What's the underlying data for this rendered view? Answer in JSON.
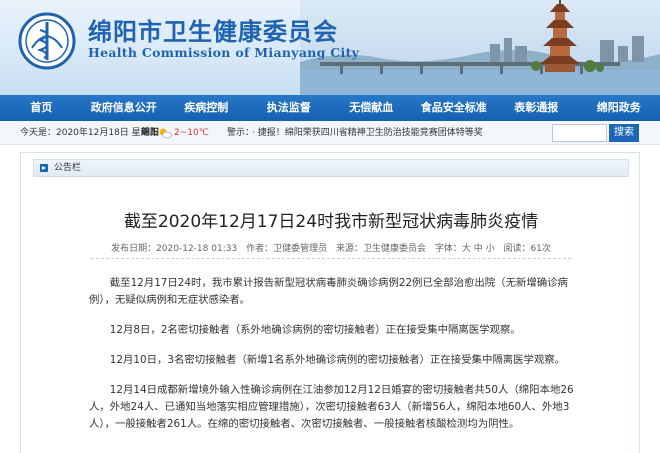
{
  "header": {
    "title_cn": "绵阳市卫生健康委员会",
    "title_en": "Health Commission of Mianyang City",
    "brand_color": "#1f63b0"
  },
  "nav": {
    "items": [
      {
        "label": "首页"
      },
      {
        "label": "政府信息公开"
      },
      {
        "label": "疾病控制"
      },
      {
        "label": "执法监督"
      },
      {
        "label": "无偿献血"
      },
      {
        "label": "食品安全标准"
      },
      {
        "label": "表彰通报"
      },
      {
        "label": "绵阳政务"
      }
    ],
    "color": "#1560b0"
  },
  "infobar": {
    "date": "今天是：2020年12月18日 星期五",
    "city": "绵阳",
    "temperature": "2~10℃",
    "notice_label": "警示：",
    "notice": "· 捷报！绵阳荣获四川省精神卫生防治技能竞赛团体特等奖",
    "search_label": "搜索"
  },
  "panel": {
    "section_label": "公告栏"
  },
  "article": {
    "title": "截至2020年12月17日24时我市新型冠状病毒肺炎疫情",
    "published": "发布日期：2020-12-18 01:33",
    "author": "作者：卫健委管理员",
    "source": "来源：卫生健康委员会",
    "font_size": "字体：大 中 小",
    "views": "阅读：61次",
    "paragraphs": [
      "截至12月17日24时，我市累计报告新型冠状病毒肺炎确诊病例22例已全部治愈出院（无新增确诊病例），无疑似病例和无症状感染者。",
      "12月8日，2名密切接触者（系外地确诊病例的密切接触者）正在接受集中隔离医学观察。",
      "12月10日，3名密切接触者（新增1名系外地确诊病例的密切接触者）正在接受集中隔离医学观察。",
      "12月14日成都新增境外输入性确诊病例在江油参加12月12日婚宴的密切接触者共50人（绵阳本地26人，外地24人、已通知当地落实相应管理措施），次密切接触者63人（新增56人，绵阳本地60人、外地3人），一般接触者261人。在绵的密切接触者、次密切接触者、一般接触者核酸检测均为阴性。"
    ]
  }
}
